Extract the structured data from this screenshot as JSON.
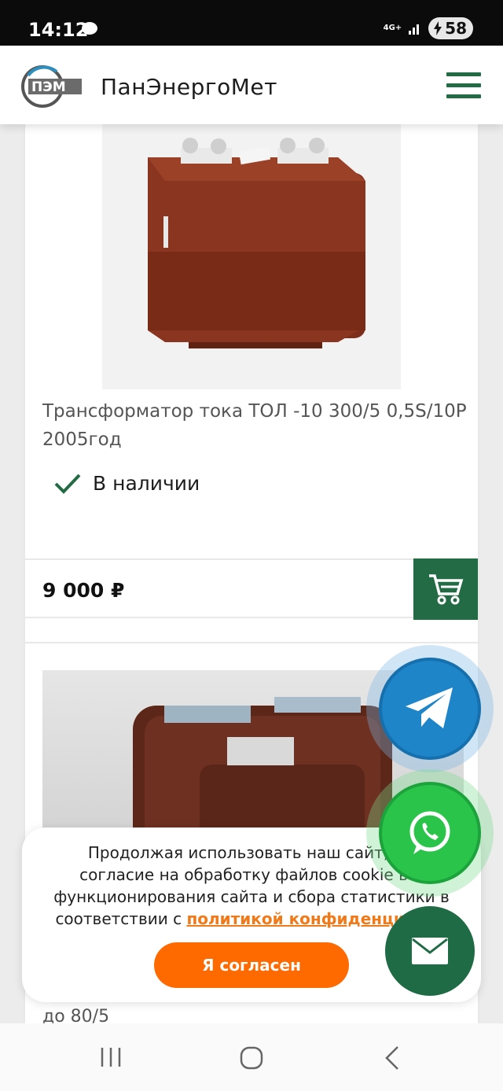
{
  "status_bar": {
    "time": "14:12",
    "network": "4G+",
    "battery": "58"
  },
  "header": {
    "logo_text": "ПЭМ",
    "brand": "ПанЭнергоМет",
    "menu_icon": "hamburger-icon"
  },
  "products": [
    {
      "title": "Трансформатор тока ТОЛ -10 300/5 0,5S/10P 2005год",
      "stock": "В наличии",
      "price": "9 000 ₽",
      "cart_icon": "cart-icon"
    },
    {
      "title": "до 80/5"
    }
  ],
  "cookie": {
    "line1": "Продолжая использовать наш сайт, вы",
    "line2": "согласие на обработку файлов cookie в ц",
    "line3": "функционирования сайта и сбора статистики в",
    "line4_prefix": "соответствии с ",
    "link": "политикой конфиденциальн",
    "button": "Я согласен"
  },
  "floating": {
    "telegram_icon": "telegram-icon",
    "whatsapp_icon": "whatsapp-icon",
    "mail_icon": "mail-icon"
  },
  "colors": {
    "brand_green": "#226b45",
    "accent_orange": "#ff6a00",
    "telegram_blue": "#1f85c9",
    "whatsapp_green": "#2ac44a"
  }
}
